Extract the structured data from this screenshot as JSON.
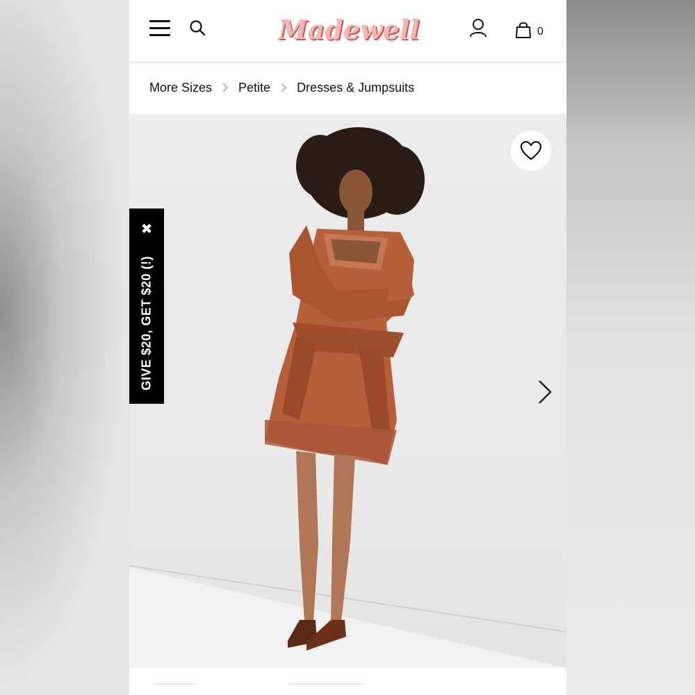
{
  "header": {
    "logo_text": "Madewell",
    "cart_count": "0",
    "icons": [
      "menu-icon",
      "search-icon",
      "account-icon",
      "shopping-bag-icon"
    ]
  },
  "breadcrumb": {
    "items": [
      {
        "label": "More Sizes"
      },
      {
        "label": "Petite"
      },
      {
        "label": "Dresses & Jumpsuits"
      }
    ]
  },
  "promo": {
    "label": "GIVE $20, GET $20 (!)",
    "close_icon": "close-icon"
  },
  "hero": {
    "favorite_icon": "heart-icon",
    "next_icon": "chevron-right-icon"
  },
  "colors": {
    "logo_fill": "#f1b7b5",
    "logo_shadow": "#c85a55",
    "dress": "#b5603b",
    "promo_bg": "#000000"
  }
}
